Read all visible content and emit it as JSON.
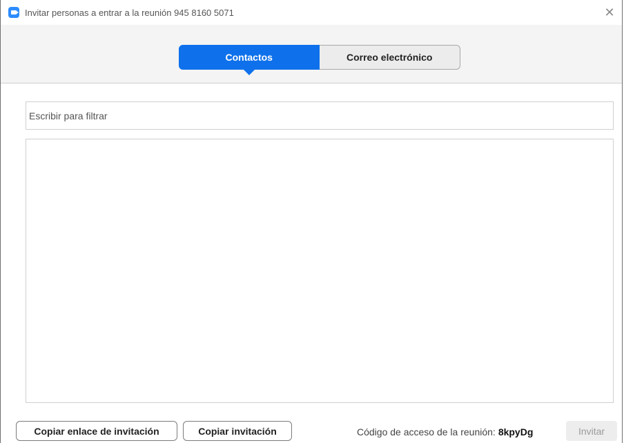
{
  "window": {
    "title": "Invitar personas a entrar a la reunión 945 8160 5071",
    "close_symbol": "✕",
    "app_icon": "zoom-camera-icon"
  },
  "tabs": [
    {
      "label": "Contactos",
      "active": true
    },
    {
      "label": "Correo electrónico",
      "active": false
    }
  ],
  "filter": {
    "placeholder": "Escribir para filtrar",
    "value": ""
  },
  "contacts": [],
  "footer": {
    "copy_link_label": "Copiar enlace de invitación",
    "copy_invite_label": "Copiar invitación",
    "passcode_label": "Código de acceso de la reunión:",
    "passcode_value": "8kpyDg",
    "invite_label": "Invitar"
  },
  "colors": {
    "accent": "#0E71EB",
    "app_icon": "#2D8CFF",
    "disabled_bg": "#ededed"
  }
}
